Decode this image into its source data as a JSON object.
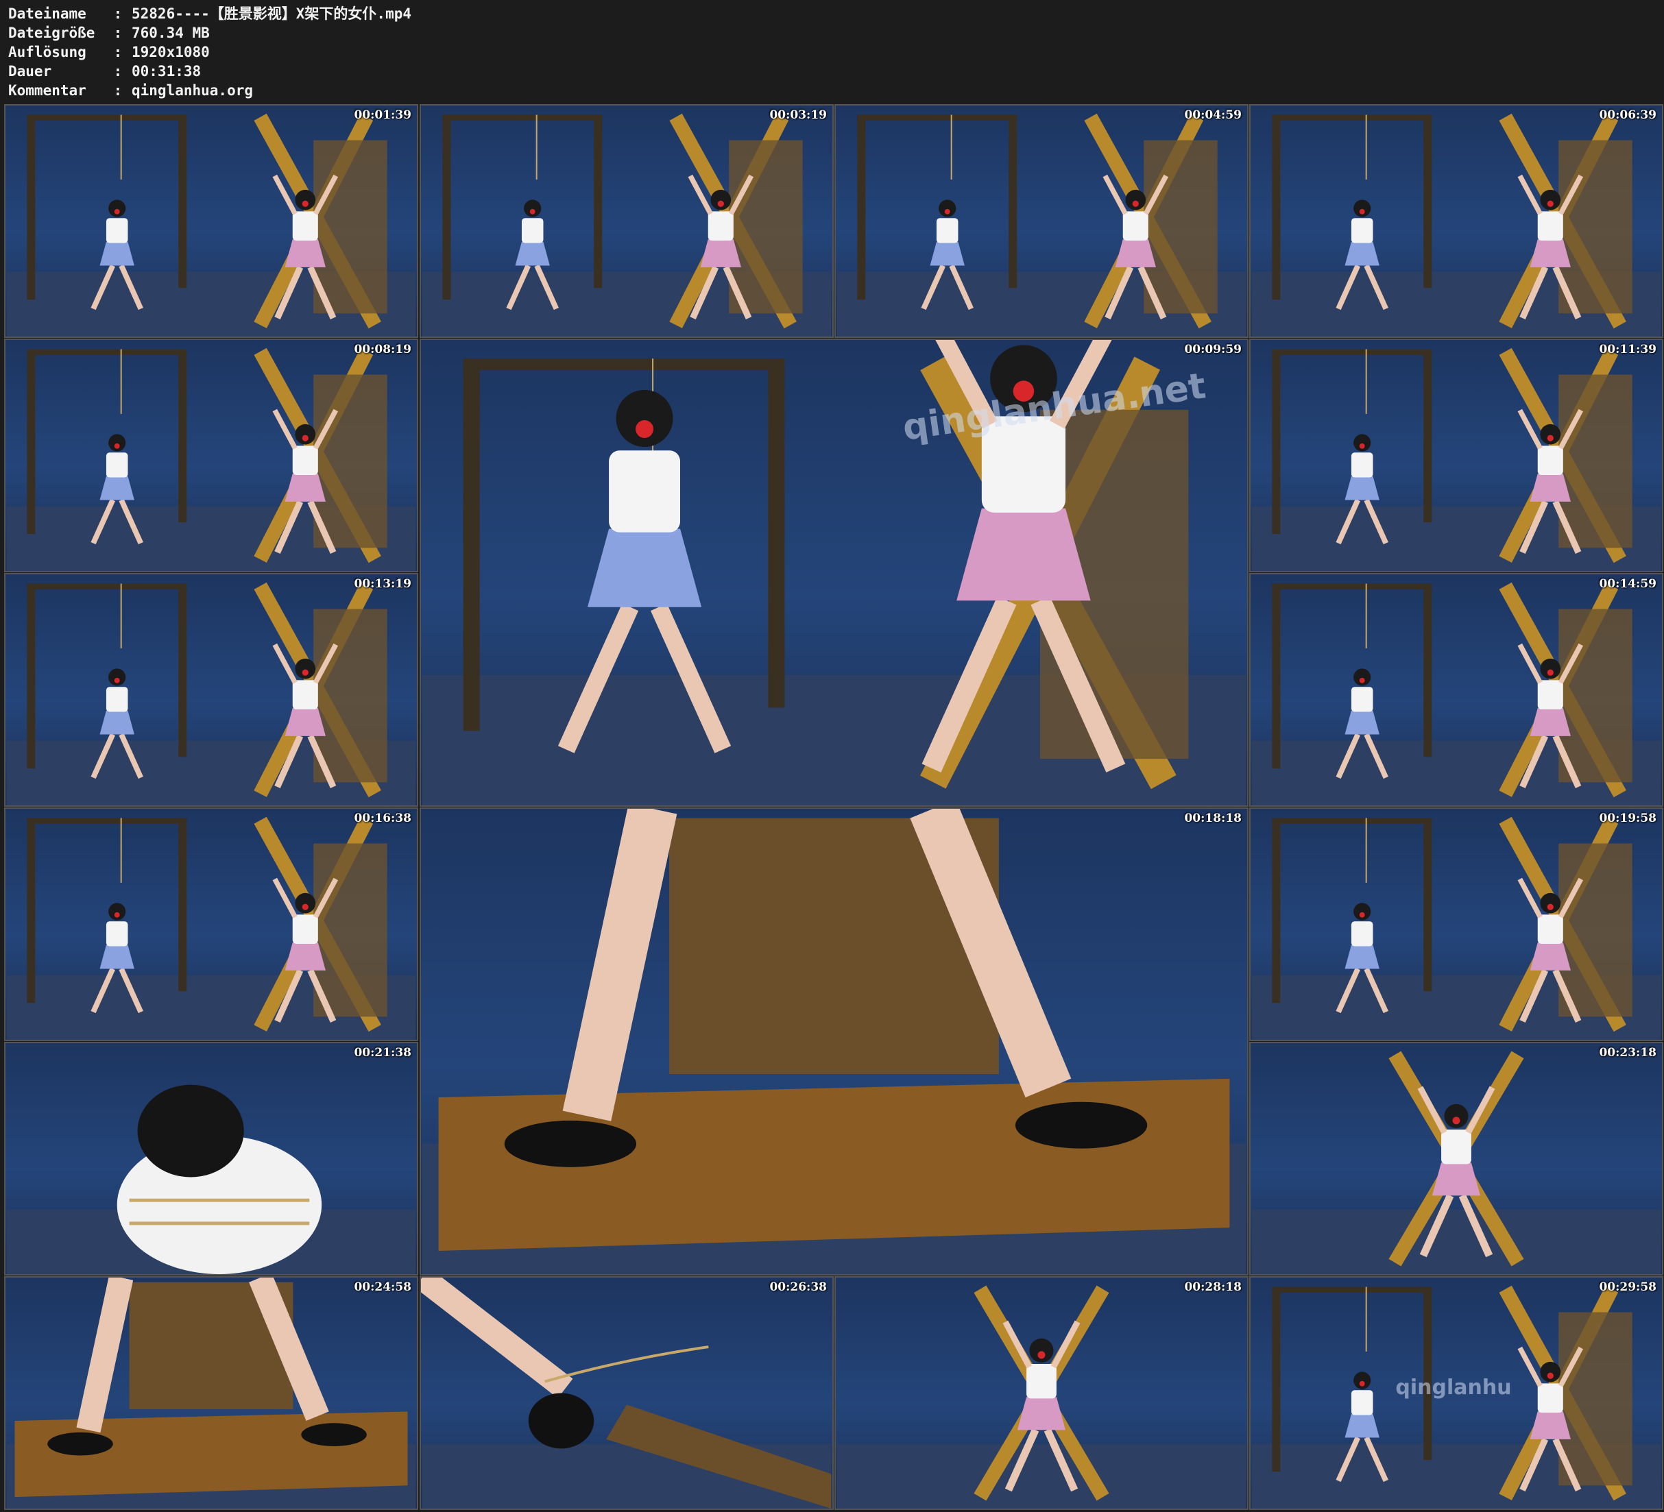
{
  "info": {
    "rows": [
      {
        "key": "Dateiname",
        "sep": ":",
        "value": "52826----【胜景影视】X架下的女仆.mp4"
      },
      {
        "key": "Dateigröße",
        "sep": ":",
        "value": "760.34 MB"
      },
      {
        "key": "Auflösung",
        "sep": ":",
        "value": "1920x1080"
      },
      {
        "key": "Dauer",
        "sep": ":",
        "value": "00:31:38"
      },
      {
        "key": "Kommentar",
        "sep": ":",
        "value": "qinglanhua.org"
      }
    ]
  },
  "thumbnails": [
    {
      "time": "00:01:39",
      "scene": "two-figures"
    },
    {
      "time": "00:03:19",
      "scene": "two-figures"
    },
    {
      "time": "00:04:59",
      "scene": "two-figures"
    },
    {
      "time": "00:06:39",
      "scene": "two-figures"
    },
    {
      "time": "00:08:19",
      "scene": "two-figures"
    },
    {
      "time": "00:09:59",
      "scene": "two-figures-close"
    },
    {
      "time": "00:11:39",
      "scene": "two-figures"
    },
    {
      "time": "00:13:19",
      "scene": "two-figures"
    },
    {
      "time": "00:14:59",
      "scene": "two-figures"
    },
    {
      "time": "00:16:38",
      "scene": "two-figures"
    },
    {
      "time": "00:18:18",
      "scene": "feet-platform"
    },
    {
      "time": "00:19:58",
      "scene": "two-figures"
    },
    {
      "time": "00:21:38",
      "scene": "torso-closeup"
    },
    {
      "time": "00:23:18",
      "scene": "single-figure"
    },
    {
      "time": "00:24:58",
      "scene": "feet-platform"
    },
    {
      "time": "00:26:38",
      "scene": "foot-rope"
    },
    {
      "time": "00:28:18",
      "scene": "single-figure"
    },
    {
      "time": "00:29:58",
      "scene": "two-figures"
    }
  ],
  "watermarks": {
    "large": "qinglanhua.net",
    "small": "qinglanhu"
  },
  "colors": {
    "background": "#1c1c1c",
    "text": "#f2f2f2",
    "scene_blue": "#24457a",
    "skirt_blue": "#8aa3e0",
    "skirt_pink": "#d79ac4",
    "wood": "#b98a2c",
    "gag_red": "#d8262b"
  }
}
